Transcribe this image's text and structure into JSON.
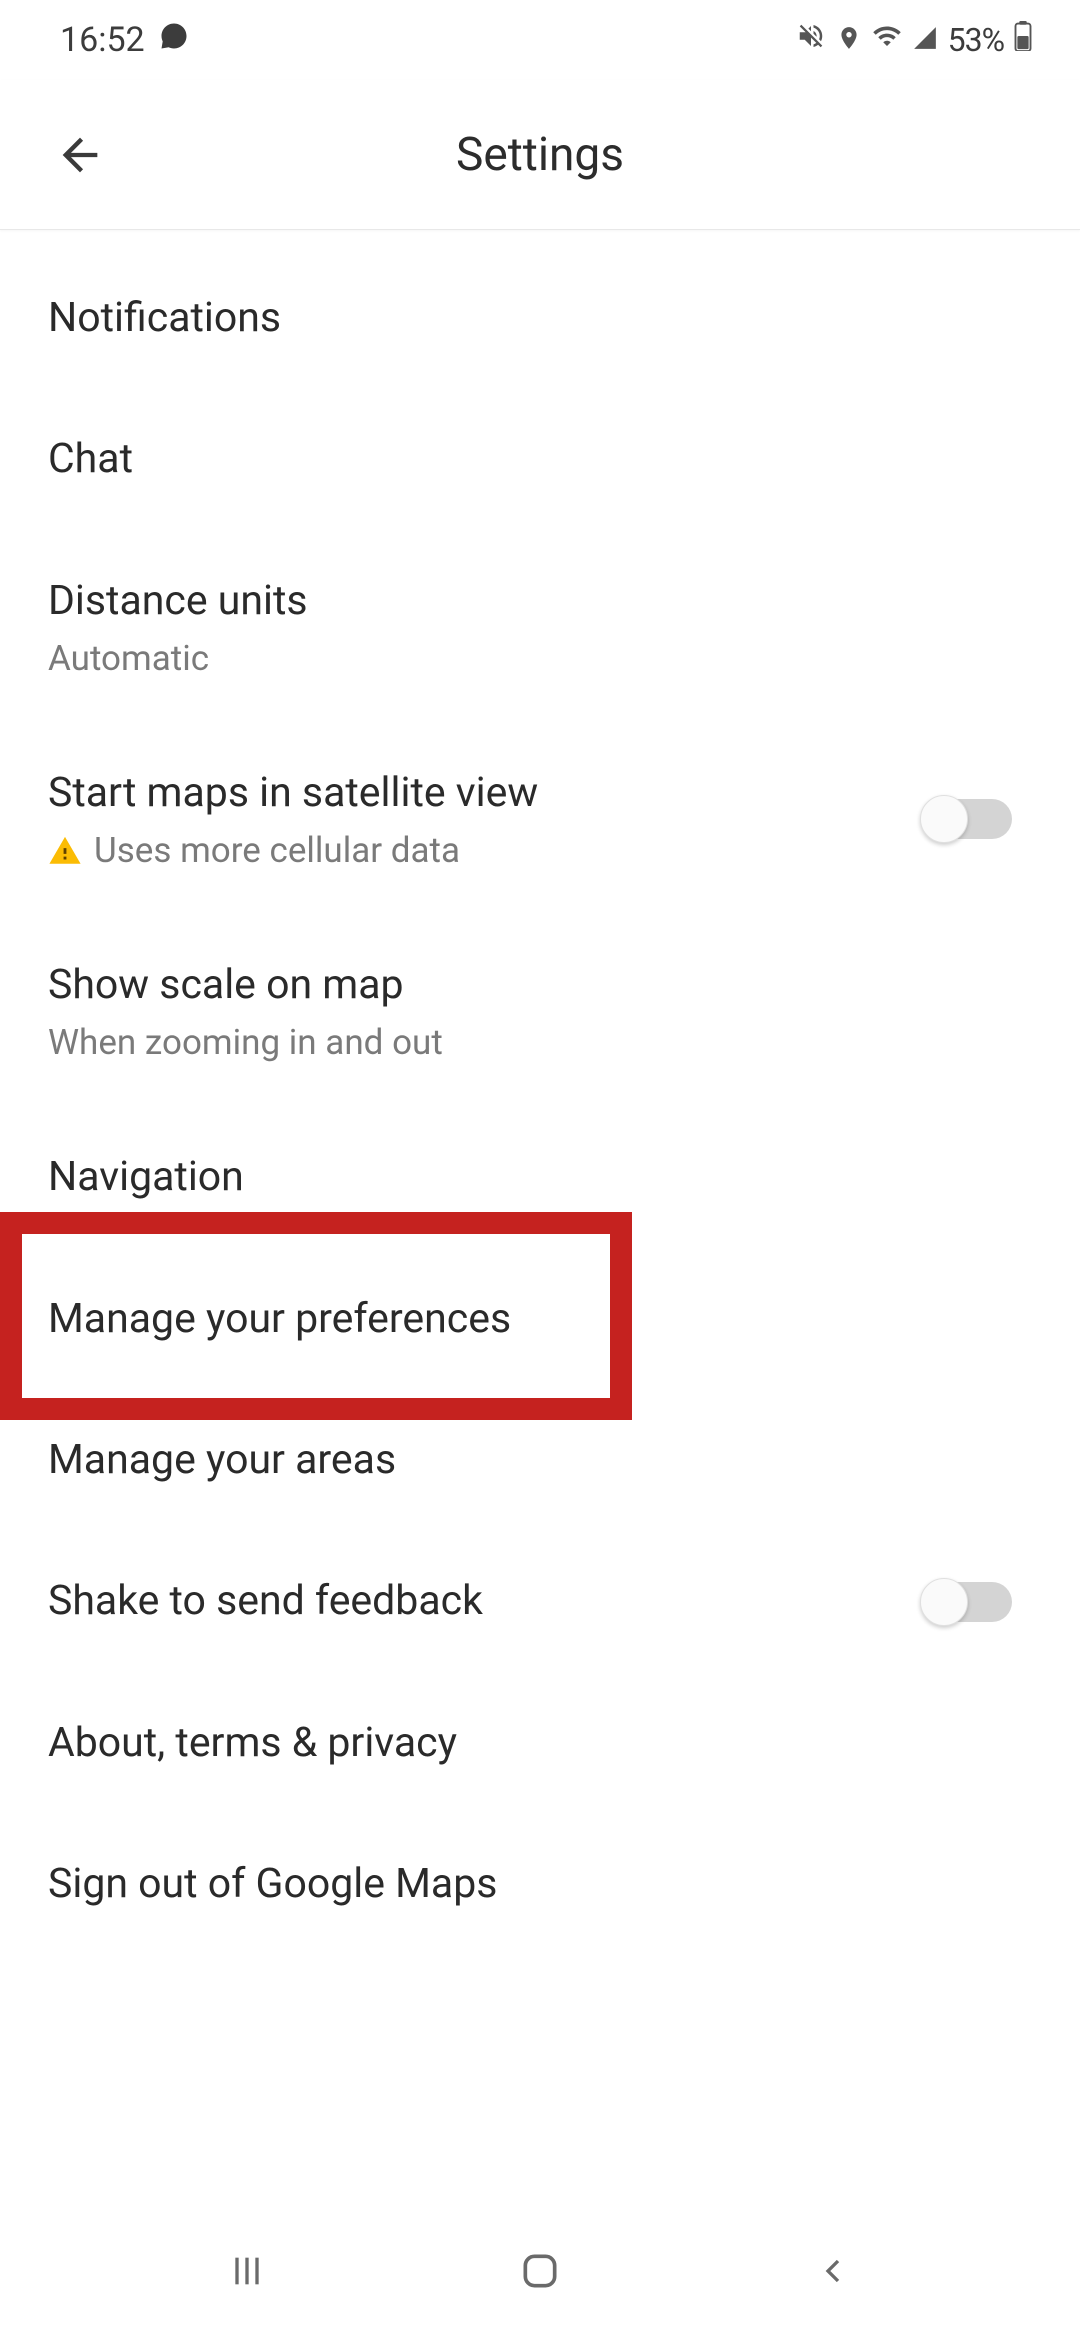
{
  "status_bar": {
    "time": "16:52",
    "battery": "53%"
  },
  "app_bar": {
    "title": "Settings"
  },
  "settings": {
    "notifications": {
      "title": "Notifications"
    },
    "chat": {
      "title": "Chat"
    },
    "distance_units": {
      "title": "Distance units",
      "subtitle": "Automatic"
    },
    "satellite_view": {
      "title": "Start maps in satellite view",
      "subtitle": "Uses more cellular data"
    },
    "scale_on_map": {
      "title": "Show scale on map",
      "subtitle": "When zooming in and out"
    },
    "navigation": {
      "title": "Navigation"
    },
    "manage_preferences": {
      "title": "Manage your preferences"
    },
    "manage_areas": {
      "title": "Manage your areas"
    },
    "shake_feedback": {
      "title": "Shake to send feedback"
    },
    "about": {
      "title": "About, terms & privacy"
    },
    "sign_out": {
      "title": "Sign out of Google Maps"
    }
  }
}
